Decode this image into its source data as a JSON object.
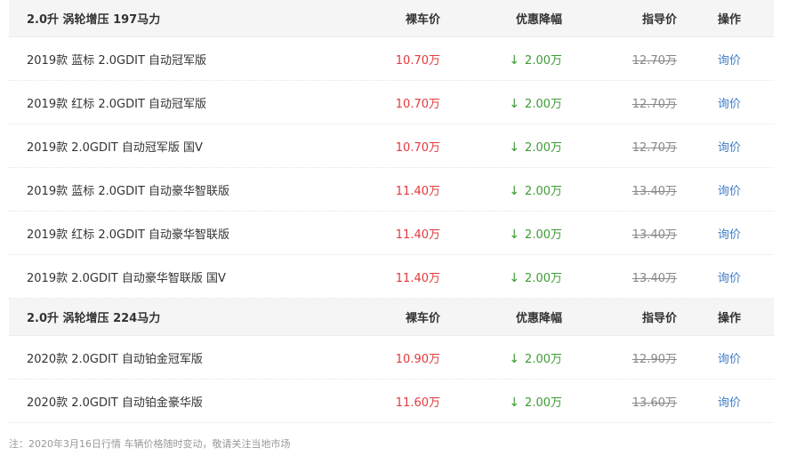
{
  "columns": {
    "price": "裸车价",
    "discount": "优惠降幅",
    "guide": "指导价",
    "action": "操作"
  },
  "groups": [
    {
      "title": "2.0升 涡轮增压 197马力",
      "rows": [
        {
          "name": "2019款 蓝标 2.0GDIT 自动冠军版",
          "price": "10.70万",
          "discount": "2.00万",
          "guide": "12.70万",
          "action": "询价"
        },
        {
          "name": "2019款 红标 2.0GDIT 自动冠军版",
          "price": "10.70万",
          "discount": "2.00万",
          "guide": "12.70万",
          "action": "询价"
        },
        {
          "name": "2019款 2.0GDIT 自动冠军版 国V",
          "price": "10.70万",
          "discount": "2.00万",
          "guide": "12.70万",
          "action": "询价"
        },
        {
          "name": "2019款 蓝标 2.0GDIT 自动豪华智联版",
          "price": "11.40万",
          "discount": "2.00万",
          "guide": "13.40万",
          "action": "询价"
        },
        {
          "name": "2019款 红标 2.0GDIT 自动豪华智联版",
          "price": "11.40万",
          "discount": "2.00万",
          "guide": "13.40万",
          "action": "询价"
        },
        {
          "name": "2019款 2.0GDIT 自动豪华智联版 国V",
          "price": "11.40万",
          "discount": "2.00万",
          "guide": "13.40万",
          "action": "询价"
        }
      ]
    },
    {
      "title": "2.0升 涡轮增压 224马力",
      "rows": [
        {
          "name": "2020款 2.0GDIT 自动铂金冠军版",
          "price": "10.90万",
          "discount": "2.00万",
          "guide": "12.90万",
          "action": "询价"
        },
        {
          "name": "2020款 2.0GDIT 自动铂金豪华版",
          "price": "11.60万",
          "discount": "2.00万",
          "guide": "13.60万",
          "action": "询价"
        }
      ]
    }
  ],
  "icons": {
    "discount_arrow": "arrow-down-icon"
  },
  "colors": {
    "price": "#e4393c",
    "discount": "#3d9b35",
    "link": "#3d7cc9",
    "guide": "#888888"
  },
  "footer_note": "注：2020年3月16日行情 车辆价格随时变动，敬请关注当地市场"
}
